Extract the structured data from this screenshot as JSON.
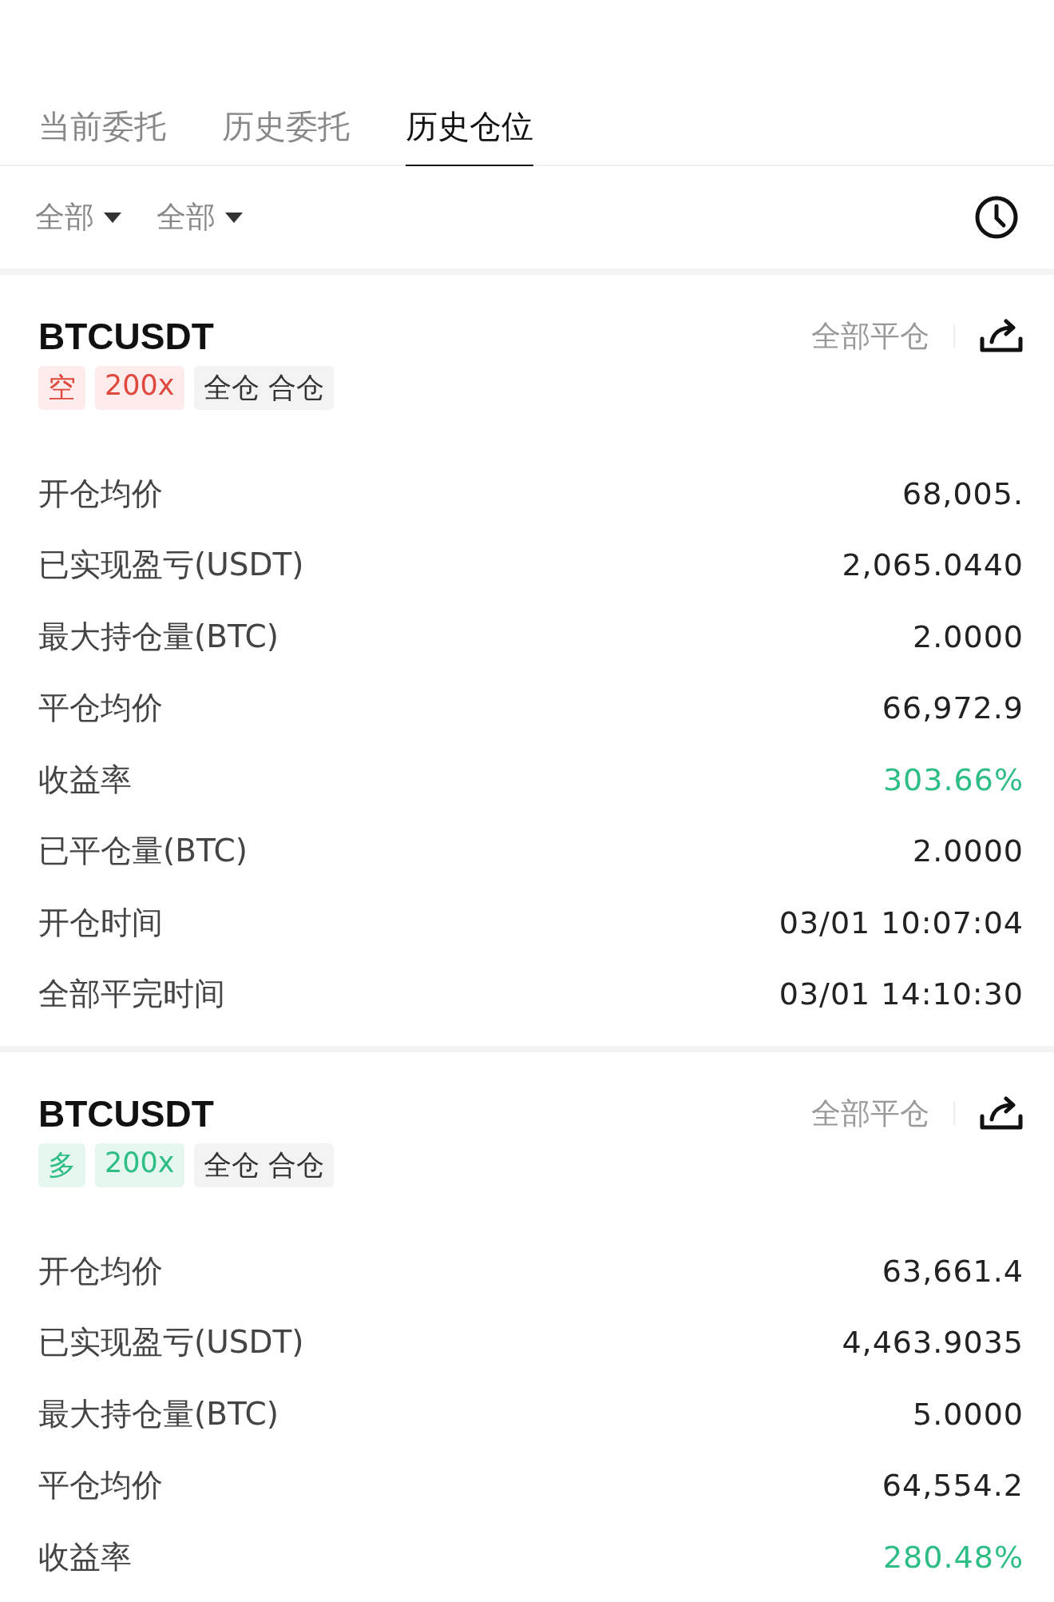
{
  "tabs": [
    {
      "label": "当前委托",
      "selected": false
    },
    {
      "label": "历史委托",
      "selected": false
    },
    {
      "label": "历史仓位",
      "selected": true
    }
  ],
  "filters": [
    "全部",
    "全部"
  ],
  "positions": [
    {
      "symbol": "BTCUSDT",
      "kind": "short",
      "side_label": "空",
      "leverage": "200x",
      "margin_mode": "全仓 合仓",
      "close_all": "全部平仓",
      "rows": [
        {
          "label": "开仓均价",
          "value": "68,005.",
          "highlight": false
        },
        {
          "label": "已实现盈亏(USDT)",
          "value": "2,065.0440",
          "highlight": false
        },
        {
          "label": "最大持仓量(BTC)",
          "value": "2.0000",
          "highlight": false
        },
        {
          "label": "平仓均价",
          "value": "66,972.9",
          "highlight": false
        },
        {
          "label": "收益率",
          "value": "303.66%",
          "highlight": true
        },
        {
          "label": "已平仓量(BTC)",
          "value": "2.0000",
          "highlight": false
        },
        {
          "label": "开仓时间",
          "value": "03/01 10:07:04",
          "highlight": false
        },
        {
          "label": "全部平完时间",
          "value": "03/01 14:10:30",
          "highlight": false
        }
      ]
    },
    {
      "symbol": "BTCUSDT",
      "kind": "long",
      "side_label": "多",
      "leverage": "200x",
      "margin_mode": "全仓 合仓",
      "close_all": "全部平仓",
      "rows": [
        {
          "label": "开仓均价",
          "value": "63,661.4",
          "highlight": false
        },
        {
          "label": "已实现盈亏(USDT)",
          "value": "4,463.9035",
          "highlight": false
        },
        {
          "label": "最大持仓量(BTC)",
          "value": "5.0000",
          "highlight": false
        },
        {
          "label": "平仓均价",
          "value": "64,554.2",
          "highlight": false
        },
        {
          "label": "收益率",
          "value": "280.48%",
          "highlight": true
        }
      ]
    }
  ]
}
